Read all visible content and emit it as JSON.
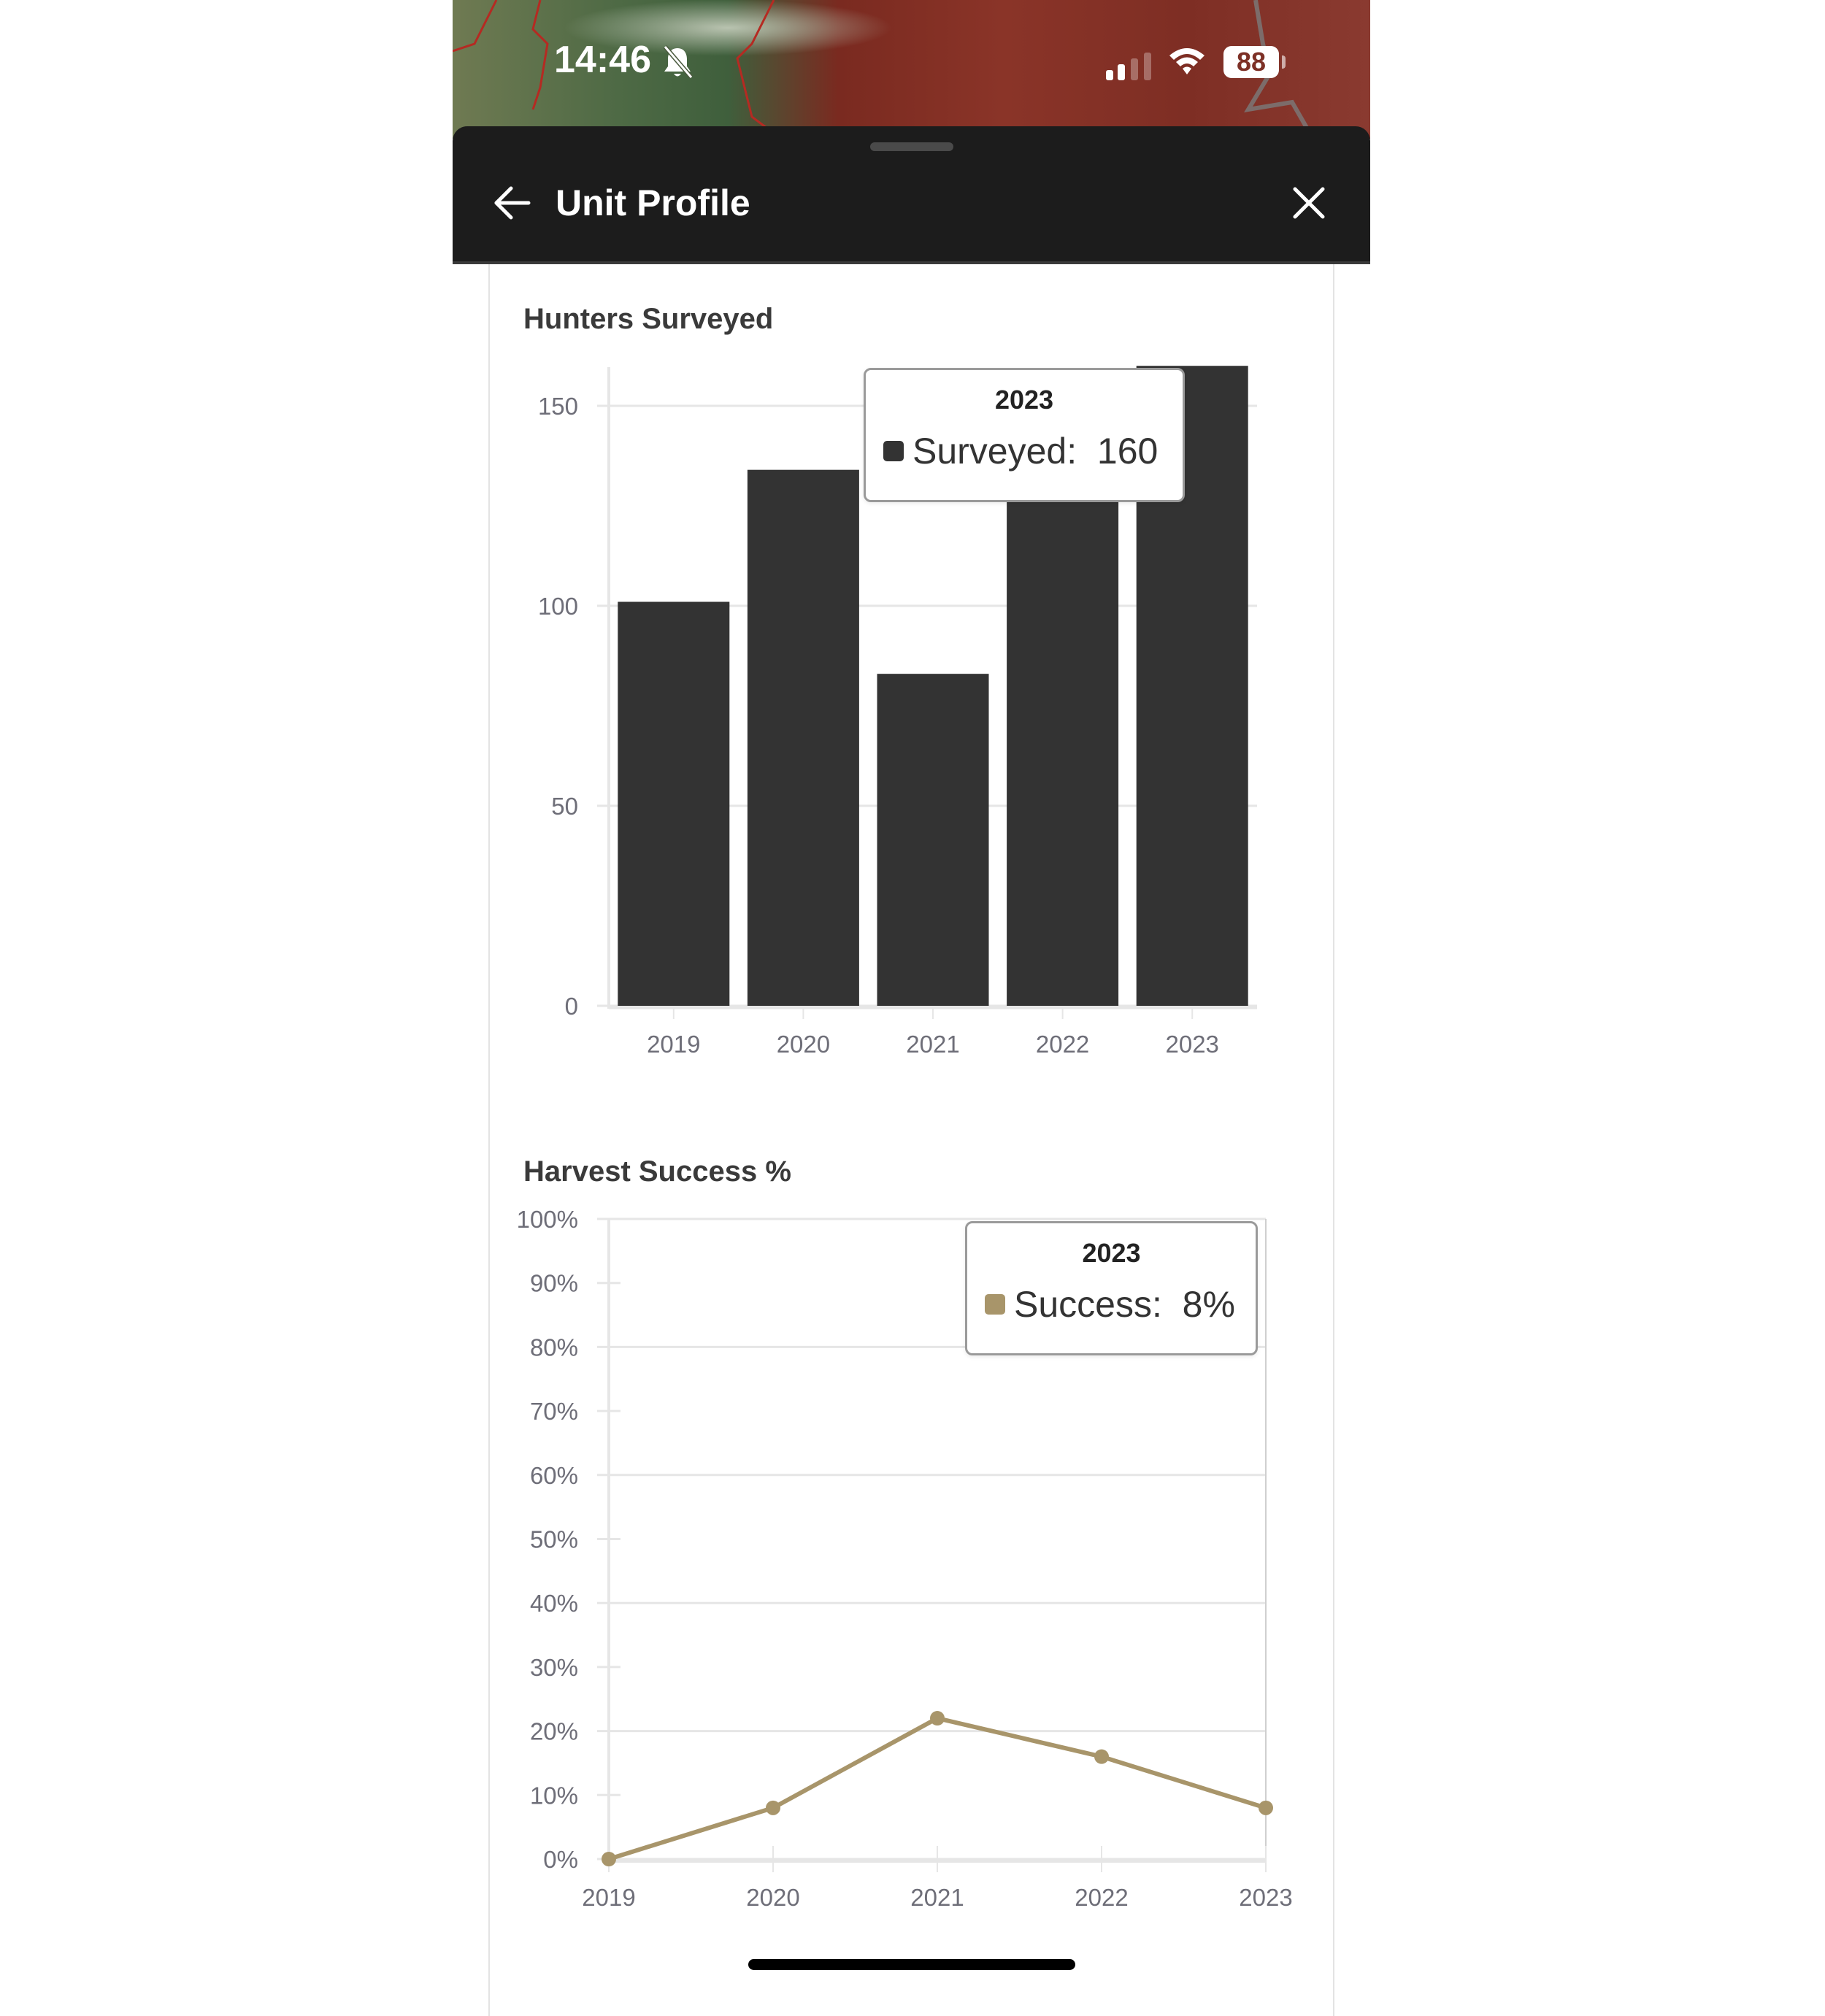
{
  "status_bar": {
    "time": "14:46",
    "silent_icon": "bell-slash-icon",
    "signal_icon": "cellular-signal-icon",
    "signal_bars_active": 2,
    "signal_bars_total": 4,
    "wifi_icon": "wifi-icon",
    "battery_percent": "88"
  },
  "header": {
    "title": "Unit Profile",
    "back_icon": "arrow-left-icon",
    "close_icon": "close-icon"
  },
  "colors": {
    "header_bg": "#1c1c1c",
    "bar_color": "#333333",
    "line_color": "#a8956a",
    "grid_color": "#e6e6e6"
  },
  "chart_data": [
    {
      "type": "bar",
      "title": "Hunters Surveyed",
      "categories": [
        "2019",
        "2020",
        "2021",
        "2022",
        "2023"
      ],
      "series": [
        {
          "name": "Surveyed",
          "values": [
            101,
            134,
            83,
            135,
            160
          ]
        }
      ],
      "xlabel": "",
      "ylabel": "",
      "ylim": [
        0,
        160
      ],
      "yticks": [
        0,
        50,
        100,
        150
      ],
      "ytick_labels": [
        "0",
        "50",
        "100",
        "150"
      ],
      "grid": true,
      "tooltip": {
        "title": "2023",
        "label": "Surveyed:",
        "value": "160"
      }
    },
    {
      "type": "line",
      "title": "Harvest Success %",
      "categories": [
        "2019",
        "2020",
        "2021",
        "2022",
        "2023"
      ],
      "series": [
        {
          "name": "Success",
          "values": [
            0,
            8,
            22,
            16,
            8
          ]
        }
      ],
      "xlabel": "",
      "ylabel": "",
      "ylim": [
        0,
        100
      ],
      "yticks": [
        0,
        10,
        20,
        30,
        40,
        50,
        60,
        70,
        80,
        90,
        100
      ],
      "ytick_labels": [
        "0%",
        "10%",
        "20%",
        "30%",
        "40%",
        "50%",
        "60%",
        "70%",
        "80%",
        "90%",
        "100%"
      ],
      "grid": true,
      "tooltip": {
        "title": "2023",
        "label": "Success:",
        "value": "8%"
      }
    }
  ]
}
